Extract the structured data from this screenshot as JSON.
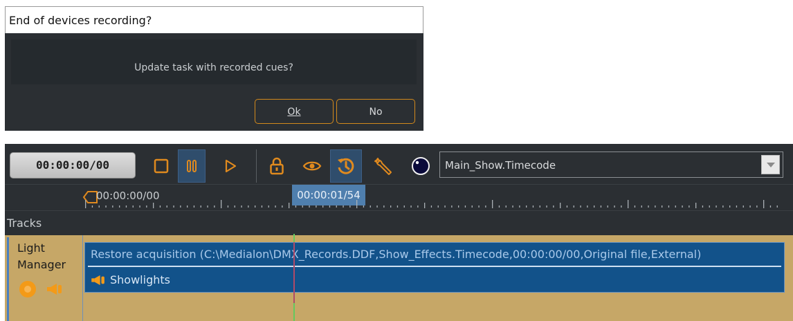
{
  "dialog": {
    "title": "End of devices recording?",
    "message": "Update task with recorded cues?",
    "ok_label": "Ok",
    "no_label": "No"
  },
  "toolbar": {
    "timecode": "00:00:00/00",
    "buttons": [
      "stop-icon",
      "pause-icon",
      "play-icon",
      "lock-icon",
      "eye-icon",
      "history-icon",
      "wrench-icon",
      "knob-icon"
    ],
    "file_select_value": "Main_Show.Timecode"
  },
  "ruler": {
    "start_timecode": "00:00:00/00",
    "current_timecode": "00:00:01/54"
  },
  "tracks": {
    "header_label": "Tracks",
    "track_name_line1": "Light",
    "track_name_line2": "Manager",
    "clip_title": "Restore acquisition (C:\\Medialon\\DMX_Records.DDF,Show_Effects.Timecode,00:00:00/00,Original file,External)",
    "clip_subtitle": "Showlights"
  },
  "colors": {
    "accent_orange": "#d48a1c",
    "active_blue": "#2f4d6c",
    "track_bg": "#c6a767",
    "clip_bg": "#12528a"
  }
}
